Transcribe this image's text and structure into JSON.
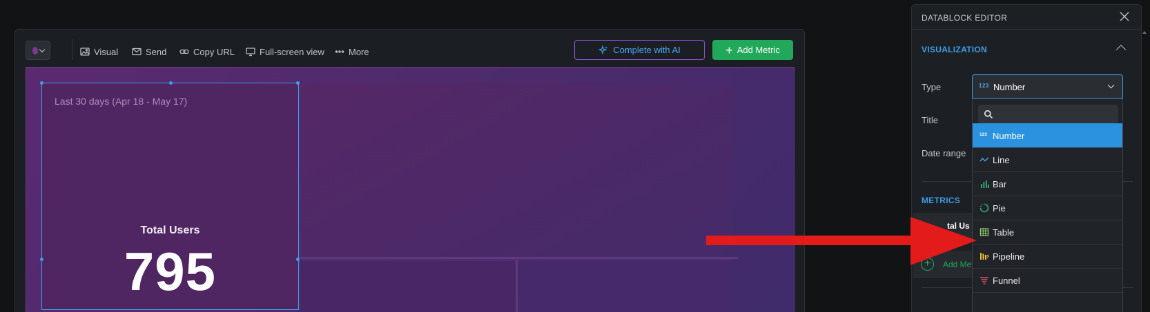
{
  "toolbar": {
    "visual_label": "Visual",
    "send_label": "Send",
    "copy_url_label": "Copy URL",
    "fullscreen_label": "Full-screen view",
    "more_label": "More",
    "ai_label": "Complete with AI",
    "add_metric_label": "Add Metric"
  },
  "tile": {
    "period": "Last 30 days (Apr 18 - May 17)",
    "metric_label": "Total Users",
    "metric_value": "795"
  },
  "editor": {
    "title": "DATABLOCK EDITOR",
    "visualization_section": "VISUALIZATION",
    "type_label": "Type",
    "title_label": "Title",
    "date_range_label": "Date range",
    "metrics_section": "METRICS",
    "metric_row_text": "tal Us",
    "add_metric_text": "Add Metr"
  },
  "type_select": {
    "value": "Number",
    "value_icon": "123",
    "search_placeholder": ""
  },
  "type_options": [
    {
      "label": "Number",
      "icon": "number-icon",
      "selected": true
    },
    {
      "label": "Line",
      "icon": "line-chart-icon",
      "selected": false
    },
    {
      "label": "Bar",
      "icon": "bar-chart-icon",
      "selected": false
    },
    {
      "label": "Pie",
      "icon": "pie-chart-icon",
      "selected": false
    },
    {
      "label": "Table",
      "icon": "table-icon",
      "selected": false
    },
    {
      "label": "Pipeline",
      "icon": "pipeline-icon",
      "selected": false
    },
    {
      "label": "Funnel",
      "icon": "funnel-icon",
      "selected": false
    }
  ],
  "colors": {
    "accent_blue": "#2a92de",
    "add_green": "#22a85b",
    "canvas_purple": "#5b2a70",
    "ai_border": "#8f55d6",
    "annotation_red": "#e31b1b"
  }
}
